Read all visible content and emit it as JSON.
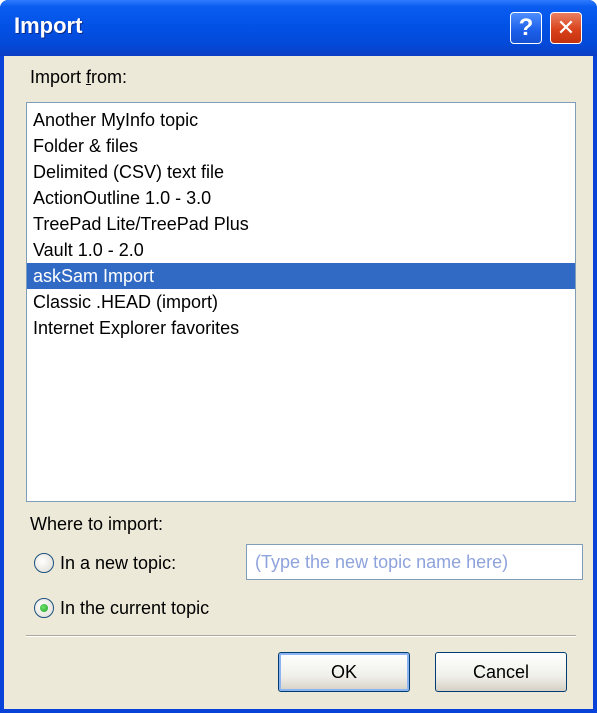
{
  "window": {
    "title": "Import",
    "help_glyph": "?",
    "close_glyph": "✕"
  },
  "import_from": {
    "label_pre": "Import ",
    "label_accel": "f",
    "label_post": "rom:",
    "items": [
      "Another MyInfo topic",
      "Folder & files",
      "Delimited (CSV) text file",
      "ActionOutline 1.0 - 3.0",
      "TreePad Lite/TreePad Plus",
      "Vault 1.0 - 2.0",
      "askSam Import",
      "Classic .HEAD (import)",
      "Internet Explorer favorites"
    ],
    "selected_index": 6
  },
  "where": {
    "label": "Where to import:",
    "new_topic_label": "In a new topic:",
    "current_topic_label": "In the current topic",
    "selected": "current",
    "new_topic_placeholder": "(Type the new topic name here)"
  },
  "buttons": {
    "ok": "OK",
    "cancel": "Cancel"
  },
  "colors": {
    "selection": "#316ac5",
    "titlebar": "#0252e6",
    "dialog_bg": "#ece9d8"
  }
}
